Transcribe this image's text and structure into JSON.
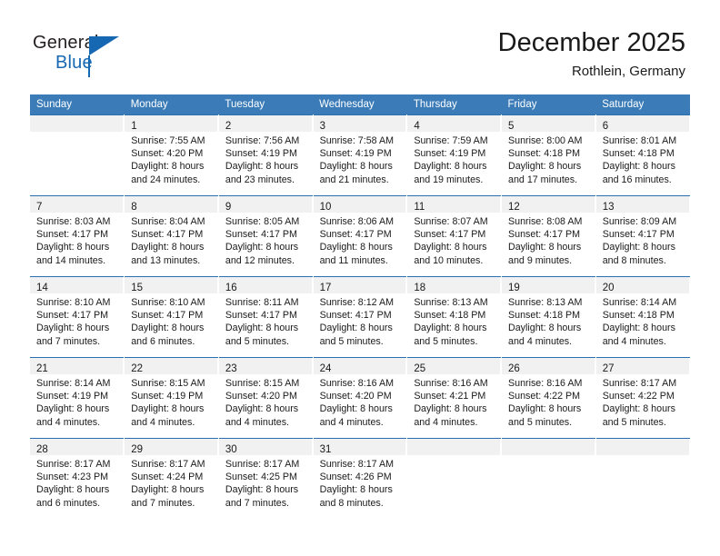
{
  "brand": {
    "name_top": "General",
    "name_bottom": "Blue",
    "accent_color": "#1668b3"
  },
  "header": {
    "title": "December 2025",
    "subtitle": "Rothlein, Germany",
    "header_bg_color": "#3b7cb8",
    "row_divider_color": "#2a6fb0",
    "daynum_strip_color": "#f1f1f1"
  },
  "weekday_headers": [
    "Sunday",
    "Monday",
    "Tuesday",
    "Wednesday",
    "Thursday",
    "Friday",
    "Saturday"
  ],
  "weeks": [
    [
      {
        "day": "",
        "lines": [
          "",
          "",
          "",
          ""
        ]
      },
      {
        "day": "1",
        "lines": [
          "Sunrise: 7:55 AM",
          "Sunset: 4:20 PM",
          "Daylight: 8 hours",
          "and 24 minutes."
        ]
      },
      {
        "day": "2",
        "lines": [
          "Sunrise: 7:56 AM",
          "Sunset: 4:19 PM",
          "Daylight: 8 hours",
          "and 23 minutes."
        ]
      },
      {
        "day": "3",
        "lines": [
          "Sunrise: 7:58 AM",
          "Sunset: 4:19 PM",
          "Daylight: 8 hours",
          "and 21 minutes."
        ]
      },
      {
        "day": "4",
        "lines": [
          "Sunrise: 7:59 AM",
          "Sunset: 4:19 PM",
          "Daylight: 8 hours",
          "and 19 minutes."
        ]
      },
      {
        "day": "5",
        "lines": [
          "Sunrise: 8:00 AM",
          "Sunset: 4:18 PM",
          "Daylight: 8 hours",
          "and 17 minutes."
        ]
      },
      {
        "day": "6",
        "lines": [
          "Sunrise: 8:01 AM",
          "Sunset: 4:18 PM",
          "Daylight: 8 hours",
          "and 16 minutes."
        ]
      }
    ],
    [
      {
        "day": "7",
        "lines": [
          "Sunrise: 8:03 AM",
          "Sunset: 4:17 PM",
          "Daylight: 8 hours",
          "and 14 minutes."
        ]
      },
      {
        "day": "8",
        "lines": [
          "Sunrise: 8:04 AM",
          "Sunset: 4:17 PM",
          "Daylight: 8 hours",
          "and 13 minutes."
        ]
      },
      {
        "day": "9",
        "lines": [
          "Sunrise: 8:05 AM",
          "Sunset: 4:17 PM",
          "Daylight: 8 hours",
          "and 12 minutes."
        ]
      },
      {
        "day": "10",
        "lines": [
          "Sunrise: 8:06 AM",
          "Sunset: 4:17 PM",
          "Daylight: 8 hours",
          "and 11 minutes."
        ]
      },
      {
        "day": "11",
        "lines": [
          "Sunrise: 8:07 AM",
          "Sunset: 4:17 PM",
          "Daylight: 8 hours",
          "and 10 minutes."
        ]
      },
      {
        "day": "12",
        "lines": [
          "Sunrise: 8:08 AM",
          "Sunset: 4:17 PM",
          "Daylight: 8 hours",
          "and 9 minutes."
        ]
      },
      {
        "day": "13",
        "lines": [
          "Sunrise: 8:09 AM",
          "Sunset: 4:17 PM",
          "Daylight: 8 hours",
          "and 8 minutes."
        ]
      }
    ],
    [
      {
        "day": "14",
        "lines": [
          "Sunrise: 8:10 AM",
          "Sunset: 4:17 PM",
          "Daylight: 8 hours",
          "and 7 minutes."
        ]
      },
      {
        "day": "15",
        "lines": [
          "Sunrise: 8:10 AM",
          "Sunset: 4:17 PM",
          "Daylight: 8 hours",
          "and 6 minutes."
        ]
      },
      {
        "day": "16",
        "lines": [
          "Sunrise: 8:11 AM",
          "Sunset: 4:17 PM",
          "Daylight: 8 hours",
          "and 5 minutes."
        ]
      },
      {
        "day": "17",
        "lines": [
          "Sunrise: 8:12 AM",
          "Sunset: 4:17 PM",
          "Daylight: 8 hours",
          "and 5 minutes."
        ]
      },
      {
        "day": "18",
        "lines": [
          "Sunrise: 8:13 AM",
          "Sunset: 4:18 PM",
          "Daylight: 8 hours",
          "and 5 minutes."
        ]
      },
      {
        "day": "19",
        "lines": [
          "Sunrise: 8:13 AM",
          "Sunset: 4:18 PM",
          "Daylight: 8 hours",
          "and 4 minutes."
        ]
      },
      {
        "day": "20",
        "lines": [
          "Sunrise: 8:14 AM",
          "Sunset: 4:18 PM",
          "Daylight: 8 hours",
          "and 4 minutes."
        ]
      }
    ],
    [
      {
        "day": "21",
        "lines": [
          "Sunrise: 8:14 AM",
          "Sunset: 4:19 PM",
          "Daylight: 8 hours",
          "and 4 minutes."
        ]
      },
      {
        "day": "22",
        "lines": [
          "Sunrise: 8:15 AM",
          "Sunset: 4:19 PM",
          "Daylight: 8 hours",
          "and 4 minutes."
        ]
      },
      {
        "day": "23",
        "lines": [
          "Sunrise: 8:15 AM",
          "Sunset: 4:20 PM",
          "Daylight: 8 hours",
          "and 4 minutes."
        ]
      },
      {
        "day": "24",
        "lines": [
          "Sunrise: 8:16 AM",
          "Sunset: 4:20 PM",
          "Daylight: 8 hours",
          "and 4 minutes."
        ]
      },
      {
        "day": "25",
        "lines": [
          "Sunrise: 8:16 AM",
          "Sunset: 4:21 PM",
          "Daylight: 8 hours",
          "and 4 minutes."
        ]
      },
      {
        "day": "26",
        "lines": [
          "Sunrise: 8:16 AM",
          "Sunset: 4:22 PM",
          "Daylight: 8 hours",
          "and 5 minutes."
        ]
      },
      {
        "day": "27",
        "lines": [
          "Sunrise: 8:17 AM",
          "Sunset: 4:22 PM",
          "Daylight: 8 hours",
          "and 5 minutes."
        ]
      }
    ],
    [
      {
        "day": "28",
        "lines": [
          "Sunrise: 8:17 AM",
          "Sunset: 4:23 PM",
          "Daylight: 8 hours",
          "and 6 minutes."
        ]
      },
      {
        "day": "29",
        "lines": [
          "Sunrise: 8:17 AM",
          "Sunset: 4:24 PM",
          "Daylight: 8 hours",
          "and 7 minutes."
        ]
      },
      {
        "day": "30",
        "lines": [
          "Sunrise: 8:17 AM",
          "Sunset: 4:25 PM",
          "Daylight: 8 hours",
          "and 7 minutes."
        ]
      },
      {
        "day": "31",
        "lines": [
          "Sunrise: 8:17 AM",
          "Sunset: 4:26 PM",
          "Daylight: 8 hours",
          "and 8 minutes."
        ]
      },
      {
        "day": "",
        "lines": [
          "",
          "",
          "",
          ""
        ]
      },
      {
        "day": "",
        "lines": [
          "",
          "",
          "",
          ""
        ]
      },
      {
        "day": "",
        "lines": [
          "",
          "",
          "",
          ""
        ]
      }
    ]
  ]
}
